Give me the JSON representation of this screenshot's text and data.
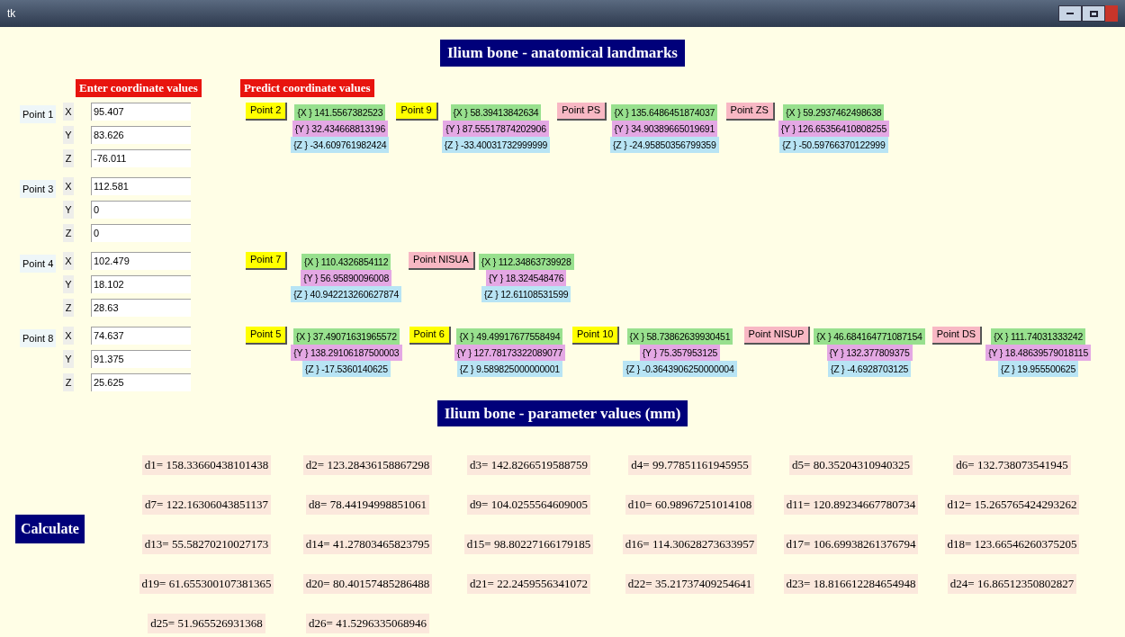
{
  "window": {
    "title": "tk"
  },
  "title": "Ilium bone - anatomical landmarks",
  "enter_header": "Enter coordinate values",
  "predict_header": "Predict coordinate values",
  "points": [
    {
      "label": "Point 1",
      "coords": [
        {
          "axis": "X",
          "value": "95.407"
        },
        {
          "axis": "Y",
          "value": "83.626"
        },
        {
          "axis": "Z",
          "value": "-76.011"
        }
      ],
      "predictions": [
        {
          "label": "Point 2",
          "color": "#ffff00",
          "values": [
            "{X } 141.5567382523",
            "{Y } 32.434668813196",
            "{Z } -34.609761982424"
          ]
        },
        {
          "label": "Point 9",
          "color": "#ffff00",
          "values": [
            "{X } 58.39413842634",
            "{Y } 87.55517874202906",
            "{Z } -33.40031732999999"
          ]
        },
        {
          "label": "Point PS",
          "color": "#f8b8c4",
          "values": [
            "{X } 135.6486451874037",
            "{Y } 34.90389665019691",
            "{Z } -24.95850356799359"
          ]
        },
        {
          "label": "Point ZS",
          "color": "#f8b8c4",
          "values": [
            "{X } 59.2937462498638",
            "{Y } 126.65356410808255",
            "{Z } -50.59766370122999"
          ]
        }
      ]
    },
    {
      "label": "Point 3",
      "coords": [
        {
          "axis": "X",
          "value": "112.581"
        },
        {
          "axis": "Y",
          "value": "0"
        },
        {
          "axis": "Z",
          "value": "0"
        }
      ]
    },
    {
      "label": "Point 4",
      "coords": [
        {
          "axis": "X",
          "value": "102.479"
        },
        {
          "axis": "Y",
          "value": "18.102"
        },
        {
          "axis": "Z",
          "value": "28.63"
        }
      ],
      "predictions": [
        {
          "label": "Point 7",
          "color": "#ffff00",
          "values": [
            "{X } 110.4326854112",
            "{Y } 56.95890096008",
            "{Z } 40.942213260627874"
          ]
        },
        {
          "label": "Point NISUA",
          "color": "#f8b8c4",
          "values": [
            "{X } 112.34863739928",
            "{Y } 18.324548476",
            "{Z } 12.61108531599"
          ]
        }
      ]
    },
    {
      "label": "Point 8",
      "coords": [
        {
          "axis": "X",
          "value": "74.637"
        },
        {
          "axis": "Y",
          "value": "91.375"
        },
        {
          "axis": "Z",
          "value": "25.625"
        }
      ],
      "predictions": [
        {
          "label": "Point 5",
          "color": "#ffff00",
          "values": [
            "{X } 37.49071631965572",
            "{Y } 138.29106187500003",
            "{Z } -17.5360140625"
          ]
        },
        {
          "label": "Point 6",
          "color": "#ffff00",
          "values": [
            "{X } 49.49917677558494",
            "{Y } 127.78173322089077",
            "{Z } 9.589825000000001"
          ]
        },
        {
          "label": "Point 10",
          "color": "#ffff00",
          "values": [
            "{X } 58.73862639930451",
            "{Y } 75.357953125",
            "{Z } -0.3643906250000004"
          ]
        },
        {
          "label": "Point NISUP",
          "color": "#f8b8c4",
          "values": [
            "{X } 46.684164771087154",
            "{Y } 132.377809375",
            "{Z } -4.6928703125"
          ]
        },
        {
          "label": "Point DS",
          "color": "#f8b8c4",
          "values": [
            "{X } 111.74031333242",
            "{Y } 18.48639579018115",
            "{Z } 19.955500625"
          ]
        }
      ]
    }
  ],
  "params_title": "Ilium bone - parameter values (mm)",
  "params": [
    "d1= 158.33660438101438",
    "d2= 123.28436158867298",
    "d3= 142.8266519588759",
    "d4= 99.77851161945955",
    "d5= 80.35204310940325",
    "d6= 132.738073541945",
    "d7= 122.16306043851137",
    "d8= 78.44194998851061",
    "d9= 104.0255564609005",
    "d10= 60.98967251014108",
    "d11= 120.89234667780734",
    "d12= 15.265765424293262",
    "d13= 55.58270210027173",
    "d14= 41.27803465823795",
    "d15= 98.80227166179185",
    "d16= 114.30628273633957",
    "d17= 106.69938261376794",
    "d18= 123.66546260375205",
    "d19= 61.655300107381365",
    "d20= 80.40157485286488",
    "d21= 22.2459556341072",
    "d22= 35.21737409254641",
    "d23= 18.816612284654948",
    "d24= 16.86512350802827",
    "d25= 51.965526931368",
    "d26= 41.5296335068946"
  ],
  "calculate_button": "Calculate"
}
